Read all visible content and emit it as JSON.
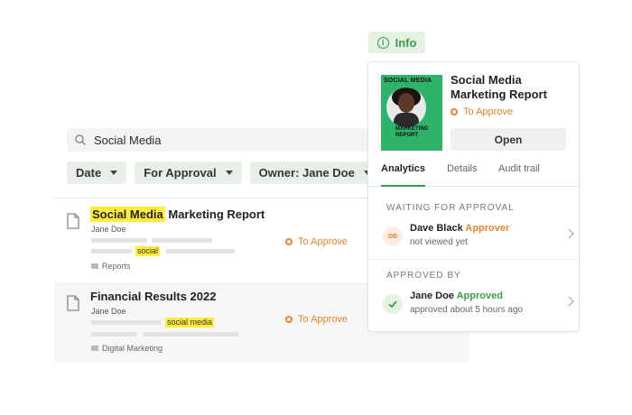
{
  "search": {
    "query": "Social Media"
  },
  "filters": [
    {
      "label": "Date"
    },
    {
      "label": "For Approval"
    },
    {
      "label": "Owner: Jane Doe"
    }
  ],
  "results": [
    {
      "title_highlight": "Social Media",
      "title_rest": " Marketing Report",
      "owner": "Jane Doe",
      "tag": "social",
      "folder": "Reports",
      "status": "To Approve"
    },
    {
      "title_highlight": "",
      "title_rest": "Financial Results 2022",
      "owner": "Jane Doe",
      "tag": "social media",
      "folder": "Digital Marketing",
      "status": "To Approve"
    }
  ],
  "info_button": {
    "label": "Info"
  },
  "card": {
    "thumbnail_top": "SOCIAL MEDIA",
    "thumbnail_bottom_1": "MARKETING",
    "thumbnail_bottom_2": "REPORT",
    "title": "Social Media Marketing Report",
    "status": "To Approve",
    "open_label": "Open",
    "tabs": [
      {
        "label": "Analytics",
        "active": true
      },
      {
        "label": "Details",
        "active": false
      },
      {
        "label": "Audit trail",
        "active": false
      }
    ],
    "waiting_heading": "WAITING FOR APPROVAL",
    "approved_heading": "APPROVED BY",
    "waiting": {
      "initials": "DB",
      "name": "Dave Black",
      "role": "Approver",
      "sub": "not viewed yet"
    },
    "approved": {
      "name": "Jane Doe",
      "role": "Approved",
      "sub": "approved about 5 hours ago"
    }
  },
  "colors": {
    "accent_green": "#3d9b4c",
    "status_orange": "#e8832d",
    "highlight_yellow": "#ffec3d",
    "chip_bg": "#e8efe8"
  }
}
